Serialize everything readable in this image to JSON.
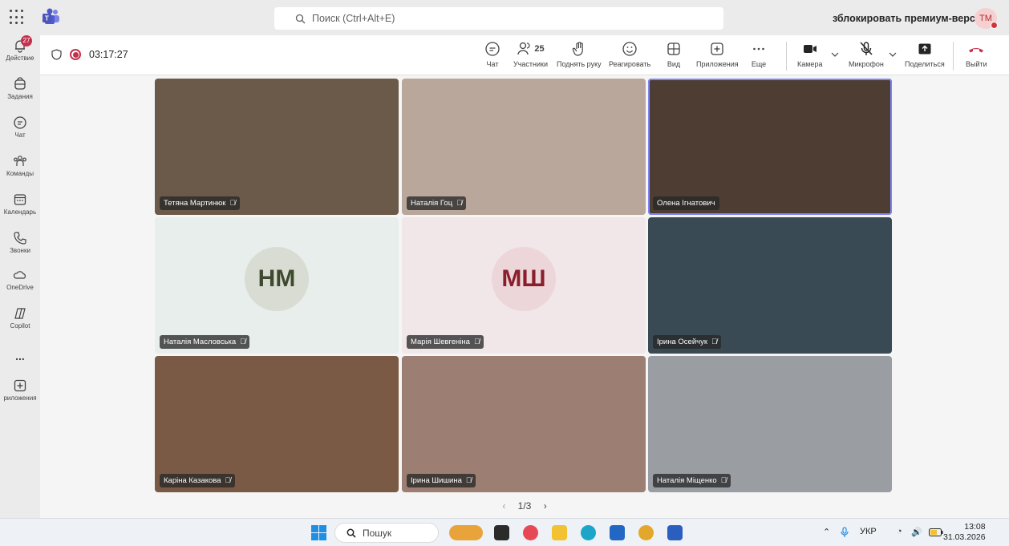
{
  "topbar": {
    "search_placeholder": "Поиск (Ctrl+Alt+E)",
    "premium_text": "зблокировать премиум-версию",
    "user_initials": "TM"
  },
  "rail": {
    "items": [
      {
        "label": "Действие",
        "icon": "bell-icon",
        "badge": "27"
      },
      {
        "label": "Задания",
        "icon": "tasks-icon"
      },
      {
        "label": "Чат",
        "icon": "chat-icon"
      },
      {
        "label": "Команды",
        "icon": "teams-icon"
      },
      {
        "label": "Календарь",
        "icon": "calendar-icon"
      },
      {
        "label": "Звонки",
        "icon": "phone-icon"
      },
      {
        "label": "OneDrive",
        "icon": "cloud-icon"
      },
      {
        "label": "Copilot",
        "icon": "copilot-icon"
      },
      {
        "label": "...",
        "icon": "more-icon"
      },
      {
        "label": "риложения",
        "icon": "add-apps-icon"
      }
    ]
  },
  "meeting": {
    "timer": "03:17:27",
    "participants_count": "25",
    "toolbar": {
      "chat": "Чат",
      "participants": "Участники",
      "raise_hand": "Поднять руку",
      "react": "Реагировать",
      "view": "Вид",
      "apps": "Приложения",
      "more": "Еще",
      "camera": "Камера",
      "mic": "Микрофон",
      "share": "Поделиться",
      "leave": "Выйти"
    }
  },
  "tiles": [
    {
      "name": "Тетяна Мартинюк",
      "type": "video",
      "bg": "#6b5a4a"
    },
    {
      "name": "Наталія Гоц",
      "type": "video",
      "bg": "#b8a79a"
    },
    {
      "name": "Олена Ігнатович",
      "type": "video",
      "bg": "#4e3d33",
      "active": true
    },
    {
      "name": "Наталія Масловська",
      "type": "avatar",
      "initials": "НМ",
      "bg": "#e8eeec",
      "avatar_bg": "#d8dcd2",
      "avatar_color": "#3e4a2e"
    },
    {
      "name": "Марія Шевгеніна",
      "type": "avatar",
      "initials": "МШ",
      "bg": "#f1e6e8",
      "avatar_bg": "#ecd6da",
      "avatar_color": "#8a1f2c"
    },
    {
      "name": "Ірина Осейчук",
      "type": "video",
      "bg": "#3a4a55"
    },
    {
      "name": "Каріна Казакова",
      "type": "video",
      "bg": "#7a5a44"
    },
    {
      "name": "Ірина Шишина",
      "type": "video",
      "bg": "#9c7f72"
    },
    {
      "name": "Наталія Міщенко",
      "type": "video",
      "bg": "#9a9ea3"
    }
  ],
  "pager": {
    "text": "1/3"
  },
  "taskbar": {
    "search": "Пошук",
    "lang": "УКР",
    "time": "13:08",
    "date": "31.03.2026"
  }
}
